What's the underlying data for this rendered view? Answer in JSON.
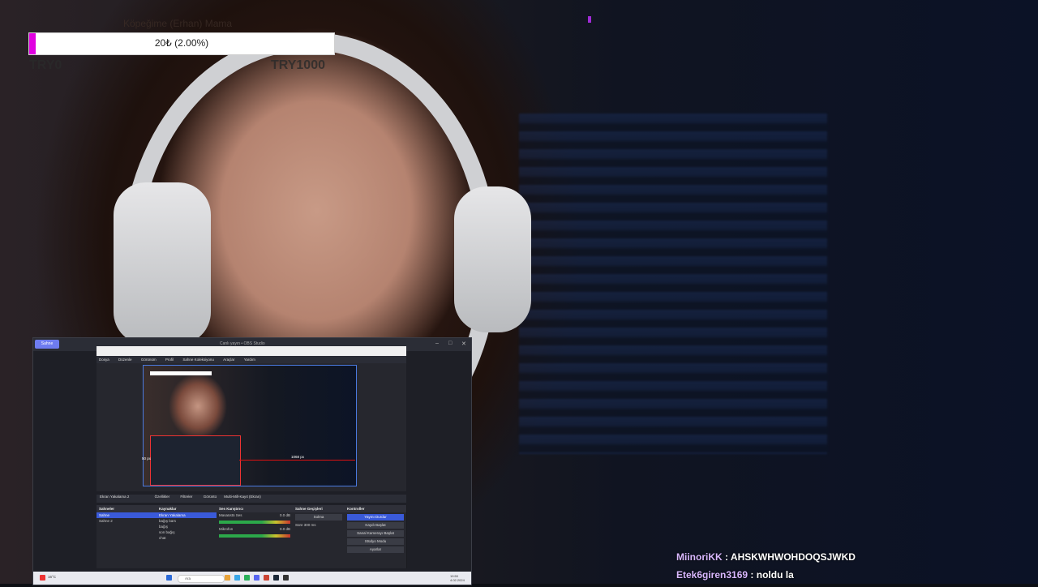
{
  "donation_goal": {
    "title": "Köpeğime (Erhan) Mama",
    "progress_label": "20₺ (2.00%)",
    "progress_fraction": 0.02,
    "min_label": "TRY0",
    "max_label": "TRY1000",
    "fill_color": "#e000e0"
  },
  "obs_window": {
    "title_tab": "Sahne",
    "title": "Canlı yayın • OBS Studio",
    "inner_menu": [
      "Dosya",
      "Düzenle",
      "Görünüm",
      "Profil",
      "Sahne Koleksiyonu",
      "Araçlar",
      "Yardım"
    ],
    "preview_labels": {
      "left_px": "50 px",
      "bottom_px": "1068 px"
    },
    "scene_bar": [
      "Ekran Yakalama 2",
      "Özellikler",
      "Filtreler",
      "Görüntü",
      "Multi-Mill-Kayıt (Ekran)"
    ],
    "docks": {
      "scenes": {
        "header": "Sahneler",
        "items": [
          "Sahne",
          "Sahne 2"
        ],
        "selected": "Sahne"
      },
      "sources": {
        "header": "Kaynaklar",
        "items": [
          "Ekran Yakalama",
          "bağış bars",
          "bağış",
          "son bağış",
          "chat"
        ]
      },
      "audio": {
        "header": "Ses Karıştırıcı",
        "channels": [
          "Masaüstü Ses",
          "Mikrofon"
        ],
        "levels": [
          "0.0 dB",
          "0.0 dB"
        ]
      },
      "transitions": {
        "header": "Sahne Geçişleri",
        "type": "Solma",
        "duration_label": "Süre",
        "duration": "300 ms"
      },
      "controls": {
        "header": "Kontroller",
        "buttons": [
          "Yayını Durdur",
          "Kaydı Başlat",
          "Sanal Kamerayı Başlat",
          "Stüdyo Modu",
          "Ayarlar"
        ]
      }
    },
    "taskbar": {
      "weather": "16°C",
      "search_placeholder": "Ara",
      "clock_time": "19:50",
      "clock_date": "4.02.2024"
    }
  },
  "chat": [
    {
      "user": "MiinoriKK",
      "message": "AHSKWHWOHDOQSJWKD"
    },
    {
      "user": "Etek6giren3169",
      "message": "noldu la"
    }
  ]
}
